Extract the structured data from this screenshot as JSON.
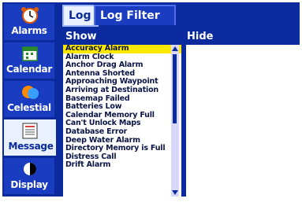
{
  "sidebar": {
    "items": [
      {
        "label": "Alarms",
        "icon": "alarm-clock-icon"
      },
      {
        "label": "Calendar",
        "icon": "calendar-icon"
      },
      {
        "label": "Celestial",
        "icon": "sun-moon-icon"
      },
      {
        "label": "Message",
        "icon": "message-icon"
      },
      {
        "label": "Display",
        "icon": "display-icon"
      }
    ]
  },
  "tabs": {
    "log": "Log",
    "log_filter": "Log Filter"
  },
  "columns": {
    "show": "Show",
    "hide": "Hide"
  },
  "show_list": [
    "Accuracy Alarm",
    "Alarm Clock",
    "Anchor Drag Alarm",
    "Antenna Shorted",
    "Approaching Waypoint",
    "Arriving at Destination",
    "Basemap Failed",
    "Batteries Low",
    "Calendar Memory Full",
    "Can't Unlock Maps",
    "Database Error",
    "Deep Water Alarm",
    "Directory Memory is Full",
    "Distress Call",
    "Drift Alarm"
  ],
  "colors": {
    "panel_blue": "#0a2a9e",
    "selection": "#ffe800"
  }
}
